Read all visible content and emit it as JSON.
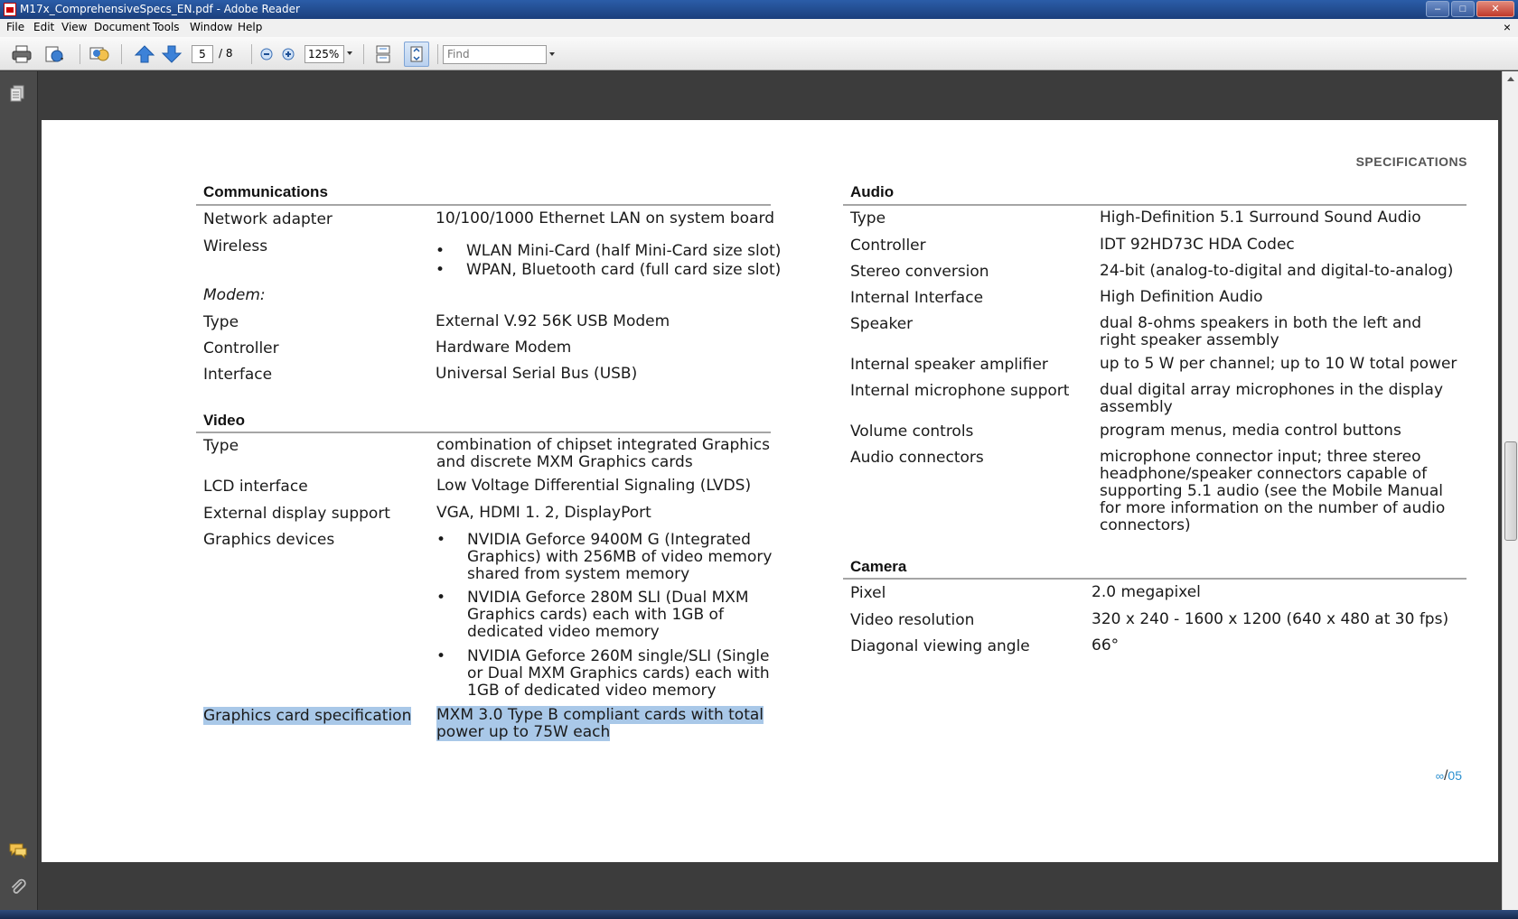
{
  "window": {
    "title": "M17x_ComprehensiveSpecs_EN.pdf - Adobe Reader",
    "minimize": "–",
    "maximize": "□",
    "close": "✕"
  },
  "menu": {
    "items": [
      "File",
      "Edit",
      "View",
      "Document",
      "Tools",
      "Window",
      "Help"
    ],
    "doc_close": "×"
  },
  "toolbar": {
    "current_page": "5",
    "total_pages": "/ 8",
    "zoom": "125%",
    "find_placeholder": "Find",
    "icons": [
      "print-icon",
      "share-icon",
      "collaborate-icon",
      "previous-page-icon",
      "next-page-icon",
      "zoom-out-icon",
      "zoom-in-icon",
      "scroll-mode-icon",
      "fit-page-icon"
    ]
  },
  "nav": {
    "icons": [
      "pages-icon",
      "comments-icon",
      "attachments-icon"
    ]
  },
  "page": {
    "header": "SPECIFICATIONS",
    "page_number": "05",
    "communications": {
      "title": "Communications",
      "network_label": "Network adapter",
      "network_value": "10/100/1000 Ethernet LAN on system board",
      "wireless_label": "Wireless",
      "wireless_items": [
        "WLAN Mini-Card (half Mini-Card size slot)",
        "WPAN, Bluetooth card (full card size slot)"
      ],
      "modem_label": "Modem:",
      "type_label": "Type",
      "type_value": "External V.92 56K USB Modem",
      "controller_label": "Controller",
      "controller_value": "Hardware Modem",
      "interface_label": "Interface",
      "interface_value": "Universal Serial Bus (USB)"
    },
    "video": {
      "title": "Video",
      "type_label": "Type",
      "type_value": "combination of chipset integrated Graphics and discrete MXM Graphics cards",
      "lcd_label": "LCD interface",
      "lcd_value": "Low Voltage Differential Signaling (LVDS)",
      "ext_label": "External display support",
      "ext_value": "VGA, HDMI 1. 2, DisplayPort",
      "devices_label": "Graphics devices",
      "devices": [
        "NVIDIA Geforce 9400M G (Integrated Graphics) with 256MB of video memory shared from system memory",
        "NVIDIA Geforce 280M SLI (Dual MXM Graphics cards) each with 1GB of dedicated video memory",
        "NVIDIA Geforce 260M single/SLI (Single or Dual MXM Graphics cards) each with 1GB of dedicated video memory"
      ],
      "card_spec_label": "Graphics card specification",
      "card_spec_value_1": "MXM 3.0 Type B compliant cards with total",
      "card_spec_value_2": "power up to 75W each"
    },
    "audio": {
      "title": "Audio",
      "rows": [
        {
          "label": "Type",
          "value": "High-Definition 5.1 Surround Sound Audio"
        },
        {
          "label": "Controller",
          "value": "IDT 92HD73C HDA Codec"
        },
        {
          "label": "Stereo conversion",
          "value": "24-bit (analog-to-digital and digital-to-analog)"
        },
        {
          "label": "Internal Interface",
          "value": "High Definition Audio"
        },
        {
          "label": "Speaker",
          "value": "dual 8-ohms speakers in both the left and right speaker assembly"
        },
        {
          "label": "Internal speaker amplifier",
          "value": "up to 5 W per channel; up to 10 W total power"
        },
        {
          "label": "Internal microphone support",
          "value": "dual digital array microphones in the display assembly"
        },
        {
          "label": "Volume controls",
          "value": "program menus, media control buttons"
        },
        {
          "label": "Audio connectors",
          "value": "microphone connector input; three stereo headphone/speaker connectors capable of supporting 5.1 audio (see the Mobile Manual for more information on the number of audio connectors)"
        }
      ]
    },
    "camera": {
      "title": "Camera",
      "rows": [
        {
          "label": "Pixel",
          "value": "2.0 megapixel"
        },
        {
          "label": "Video resolution",
          "value": "320 x 240 - 1600 x 1200 (640 x 480 at 30 fps)"
        },
        {
          "label": "Diagonal viewing angle",
          "value": "66°"
        }
      ]
    }
  },
  "colors": {
    "title_bar": "#1b3f7c",
    "selection": "#a9c8e8",
    "page_number": "#2a8fcf"
  }
}
